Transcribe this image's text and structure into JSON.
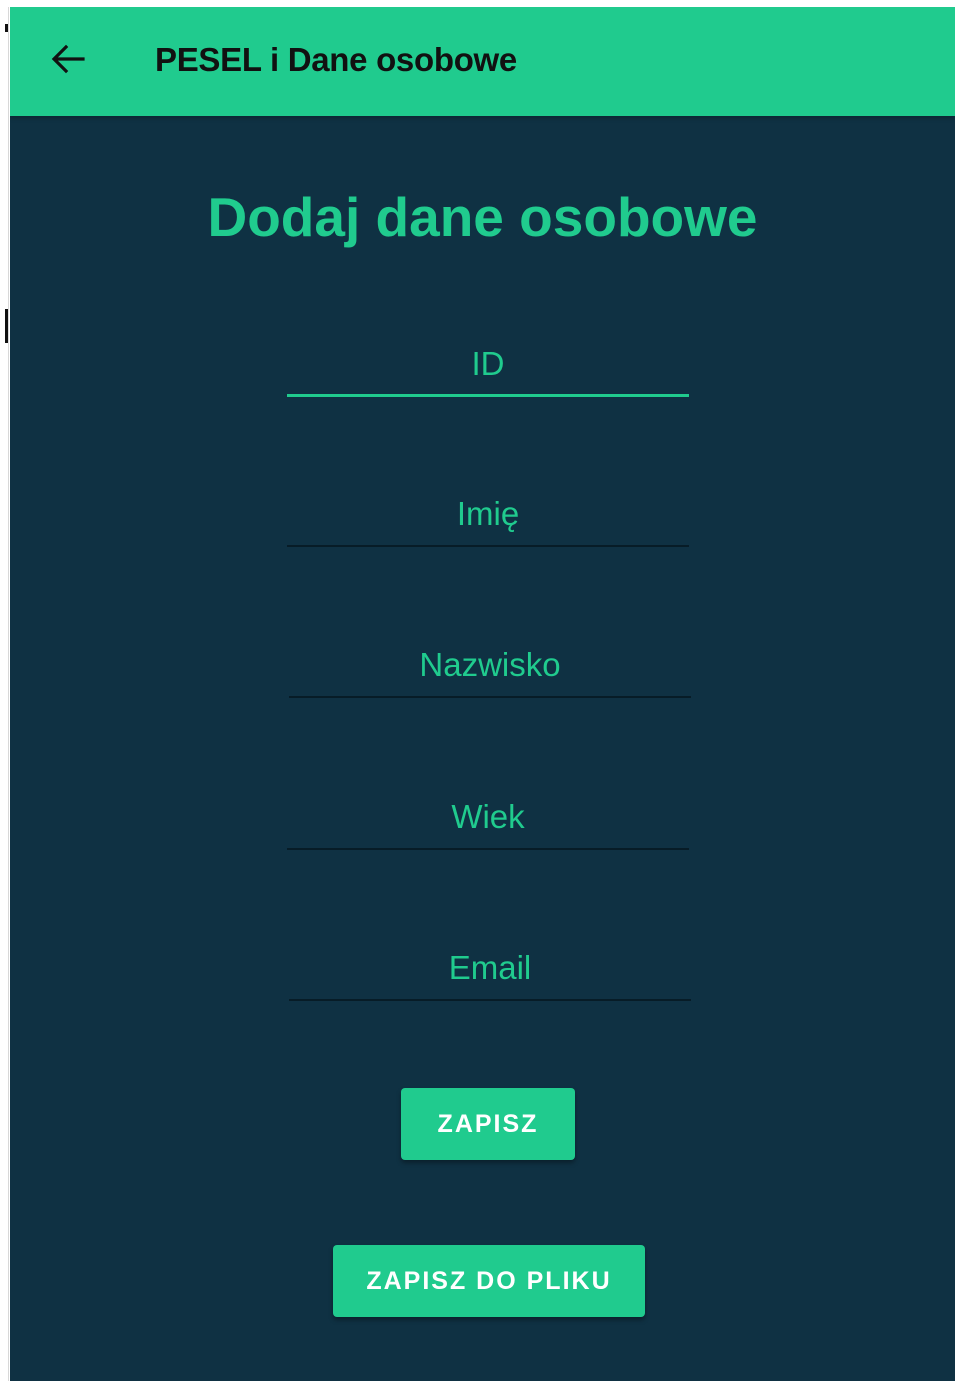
{
  "appbar": {
    "title": "PESEL i Dane osobowe",
    "back_icon": "arrow-left-icon"
  },
  "form": {
    "heading": "Dodaj dane osobowe",
    "fields": [
      {
        "key": "id",
        "value": "",
        "placeholder": "ID"
      },
      {
        "key": "first_name",
        "value": "",
        "placeholder": "Imię"
      },
      {
        "key": "last_name",
        "value": "",
        "placeholder": "Nazwisko"
      },
      {
        "key": "age",
        "value": "",
        "placeholder": "Wiek"
      },
      {
        "key": "email",
        "value": "",
        "placeholder": "Email"
      }
    ],
    "focused_field": "id",
    "save_label": "ZAPISZ",
    "save_to_file_label": "ZAPISZ DO PLIKU"
  },
  "colors": {
    "accent": "#20cb8e",
    "background": "#0f3143",
    "appbar_text": "#111111",
    "button_text": "#ffffff",
    "underline": "#071c27"
  }
}
